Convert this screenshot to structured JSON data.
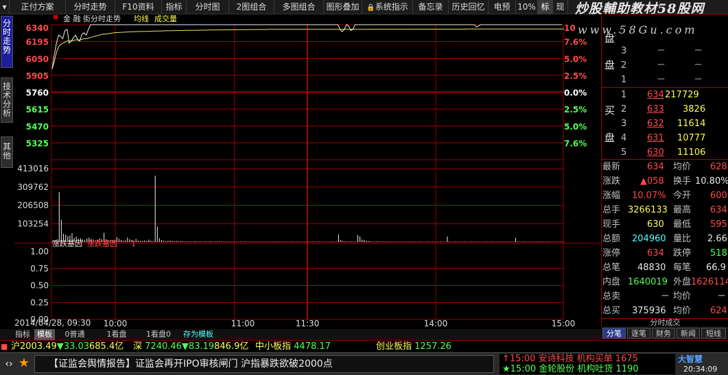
{
  "toolbar": {
    "items": [
      "正付方案",
      "分时走势",
      "F10资料",
      "指标",
      "分时图",
      "2图组合",
      "多图组合",
      "图形叠加",
      "系统指示",
      "备忘录",
      "历史回忆",
      "电预",
      "10%",
      "标",
      "现"
    ]
  },
  "watermark": {
    "line1": "炒股輔助教材58股网",
    "line2": "www.58Gu.com"
  },
  "side_tabs": [
    "分时走势",
    "技术分析",
    "其他"
  ],
  "chart_header": {
    "title": "金 融 街分时走势",
    "avg": "均线",
    "vol": "成交量"
  },
  "indicator_header": {
    "name": "涨跌基因",
    "name2": "涨跌基因",
    "val": "1"
  },
  "date_label": "2014/04/28, 09:30",
  "chart_data": {
    "type": "line",
    "price_ticks": [
      "6340",
      "6195",
      "6050",
      "5905",
      "5760",
      "5615",
      "5470",
      "5325"
    ],
    "pct_ticks": [
      "10",
      "7.6%",
      "5.0%",
      "2.5%",
      "0.0%",
      "2.5%",
      "5.0%",
      "7.6%"
    ],
    "vol_ticks": [
      "413016",
      "309762",
      "206508",
      "103254"
    ],
    "ind_ticks": [
      "1.00",
      "0.75",
      "0.50",
      "0.25",
      "0.00"
    ],
    "time_ticks": [
      "10:00",
      "11:00",
      "11:30",
      "14:00",
      "15:00"
    ],
    "ylim": [
      5180,
      6340
    ],
    "prev_close": 5760,
    "price_series": [
      5960,
      6080,
      6180,
      6250,
      6240,
      6220,
      6290,
      6300,
      6180,
      6200,
      6230,
      6250,
      6210,
      6200,
      6260,
      6270,
      6250,
      6300,
      6340,
      6340,
      6340,
      6340,
      6340,
      6340,
      6340,
      6340,
      6340,
      6340,
      6340,
      6340,
      6340,
      6340,
      6340,
      6340,
      6340,
      6340,
      6340,
      6340,
      6340,
      6340,
      6340,
      6340,
      6340,
      6340,
      6340,
      6340,
      6340,
      6340,
      6340,
      6340,
      6340,
      6340,
      6340,
      6340,
      6340,
      6340,
      6340,
      6340,
      6340,
      6340,
      6340,
      6340,
      6340,
      6340,
      6340,
      6340,
      6340,
      6340,
      6340,
      6340,
      6340,
      6340,
      6340,
      6340,
      6340,
      6340,
      6340,
      6340,
      6340,
      6340,
      6340,
      6340,
      6340,
      6340,
      6340,
      6340,
      6340,
      6340,
      6340,
      6340,
      6340,
      6340,
      6340,
      6340,
      6340,
      6340,
      6340,
      6340,
      6340,
      6340,
      6340,
      6340,
      6340,
      6340,
      6340,
      6340,
      6340,
      6340,
      6340,
      6340,
      6340,
      6340,
      6340,
      6340,
      6340,
      6340,
      6340,
      6340,
      6340,
      6340,
      6340,
      6340,
      6340,
      6340,
      6340,
      6340,
      6340,
      6340,
      6340,
      6340,
      6340,
      6340,
      6340,
      6340,
      6340,
      6300,
      6280,
      6300,
      6340,
      6330,
      6290,
      6300,
      6340,
      6340,
      6340,
      6340,
      6340,
      6340,
      6340,
      6340,
      6340,
      6340,
      6340,
      6340,
      6340,
      6340,
      6340,
      6340,
      6340,
      6340,
      6340,
      6340,
      6340,
      6340,
      6340,
      6340,
      6340,
      6340,
      6340,
      6340,
      6340,
      6340,
      6340,
      6340,
      6340,
      6340,
      6340,
      6340,
      6340,
      6340,
      6340,
      6340,
      6340,
      6340,
      6340,
      6340,
      6340,
      6340,
      6340,
      6340,
      6340,
      6340,
      6340,
      6340,
      6340,
      6340,
      6340,
      6340,
      6340,
      6320,
      6330,
      6340,
      6340,
      6340,
      6340,
      6340,
      6340,
      6340,
      6340,
      6340,
      6340,
      6340,
      6340,
      6340,
      6340,
      6340,
      6340,
      6340,
      6340,
      6340,
      6340,
      6340,
      6340,
      6340,
      6340,
      6340,
      6340,
      6340,
      6340,
      6340,
      6340,
      6340,
      6340,
      6340,
      6340,
      6340,
      6340,
      6340,
      6340,
      6340
    ],
    "avg_series": [
      5960,
      6020,
      6100,
      6150,
      6170,
      6180,
      6190,
      6200,
      6200,
      6200,
      6205,
      6210,
      6210,
      6210,
      6215,
      6220,
      6220,
      6225,
      6230,
      6235,
      6240,
      6245,
      6250,
      6255,
      6258,
      6260,
      6262,
      6265,
      6268,
      6270,
      6272,
      6273,
      6274,
      6275,
      6276,
      6277,
      6278,
      6279,
      6280,
      6280,
      6281,
      6281,
      6282,
      6282,
      6283,
      6283,
      6284,
      6284,
      6285,
      6285,
      6286,
      6286,
      6287,
      6287,
      6288,
      6288,
      6289,
      6289,
      6290,
      6290,
      6290,
      6290,
      6291,
      6291,
      6291,
      6292,
      6292,
      6292,
      6292,
      6293,
      6293,
      6293,
      6293,
      6294,
      6294,
      6294,
      6294,
      6295,
      6295,
      6295,
      6295,
      6295,
      6296,
      6296,
      6296,
      6296,
      6296,
      6297,
      6297,
      6297,
      6297,
      6297,
      6298,
      6298,
      6298,
      6298,
      6298,
      6299,
      6299,
      6299,
      6299,
      6299,
      6300,
      6300,
      6300,
      6300,
      6300,
      6300,
      6300,
      6300,
      6300,
      6300,
      6300,
      6300,
      6300,
      6300,
      6300,
      6300,
      6300,
      6300,
      6300,
      6300,
      6300,
      6300,
      6300,
      6300,
      6300,
      6300,
      6300,
      6300,
      6300,
      6300,
      6300,
      6300,
      6300,
      6300,
      6300,
      6300,
      6300,
      6300,
      6300,
      6300,
      6300,
      6300,
      6300,
      6300,
      6300,
      6300,
      6300,
      6300,
      6301,
      6301,
      6301,
      6301,
      6301,
      6301,
      6301,
      6301,
      6301,
      6301,
      6301,
      6301,
      6301,
      6301,
      6301,
      6301,
      6301,
      6301,
      6301,
      6301,
      6301,
      6302,
      6302,
      6302,
      6302,
      6302,
      6302,
      6302,
      6302,
      6302,
      6302,
      6302,
      6302,
      6302,
      6302,
      6302,
      6302,
      6302,
      6302,
      6302,
      6302,
      6302,
      6302,
      6302,
      6302,
      6303,
      6303,
      6303,
      6303,
      6303,
      6303,
      6303,
      6303,
      6303,
      6303,
      6303,
      6303,
      6303,
      6303,
      6303,
      6303,
      6303,
      6303,
      6303,
      6303,
      6303,
      6303,
      6303,
      6303,
      6303,
      6303,
      6303,
      6303,
      6303,
      6303,
      6303,
      6303,
      6303,
      6303,
      6303,
      6303,
      6303,
      6303,
      6303,
      6303,
      6303,
      6303,
      6303,
      6303,
      6303,
      6303
    ],
    "volume_series": [
      8000,
      12000,
      15000,
      292000,
      130000,
      48000,
      42000,
      35000,
      38000,
      52000,
      24000,
      31000,
      18000,
      22000,
      15000,
      12000,
      20000,
      26000,
      18000,
      14000,
      11000,
      14000,
      22000,
      16000,
      54000,
      16000,
      10000,
      12000,
      9000,
      10000,
      28000,
      18000,
      12000,
      8000,
      10000,
      26000,
      16000,
      12000,
      9000,
      18000,
      8000,
      7000,
      6000,
      9000,
      7000,
      14000,
      8000,
      6000,
      388000,
      90000,
      22000,
      12000,
      8000,
      6000,
      7000,
      8000,
      6000,
      5000,
      6000,
      5000,
      4000,
      5000,
      4000,
      3000,
      4000,
      3000,
      4000,
      5000,
      3000,
      4000,
      3000,
      3000,
      4000,
      3000,
      5000,
      3000,
      3000,
      4000,
      3000,
      3000,
      2000,
      3000,
      2000,
      3000,
      2000,
      3000,
      2000,
      2000,
      3000,
      2000,
      3000,
      2000,
      2000,
      3000,
      2000,
      2000,
      3000,
      2000,
      2000,
      2000,
      3000,
      2000,
      2000,
      2000,
      3000,
      2000,
      2000,
      2000,
      3000,
      2000,
      2000,
      2000,
      3000,
      2000,
      2000,
      3000,
      2000,
      2000,
      2000,
      3000,
      2000,
      2000,
      3000,
      2000,
      2000,
      3000,
      2000,
      2000,
      2000,
      2000,
      2000,
      3000,
      2000,
      2000,
      44000,
      12000,
      6000,
      4000,
      3000,
      3000,
      4000,
      3000,
      3000,
      40000,
      32000,
      14000,
      12000,
      8000,
      6000,
      4000,
      3000,
      3000,
      4000,
      3000,
      2000,
      3000,
      2000,
      3000,
      2000,
      3000,
      2000,
      2000,
      3000,
      2000,
      2000,
      3000,
      2000,
      2000,
      3000,
      2000,
      2000,
      2000,
      3000,
      2000,
      2000,
      2000,
      3000,
      2000,
      3000,
      2000,
      2000,
      2000,
      3000,
      2000,
      2000,
      32000,
      3000,
      2000,
      2000,
      3000,
      2000,
      2000,
      2000,
      3000,
      2000,
      2000,
      3000,
      2000,
      2000,
      3000,
      2000,
      2000,
      2000,
      3000,
      2000,
      2000,
      3000,
      2000,
      2000,
      2000,
      3000,
      2000,
      2000,
      3000,
      2000,
      2000,
      2000,
      24000,
      3000,
      2000,
      2000,
      3000,
      2000,
      2000,
      2000,
      3000,
      2000,
      2000,
      3000,
      2000,
      2000,
      2000,
      3000,
      2000,
      2000,
      2000,
      2000,
      2000,
      2000,
      2000,
      2000
    ]
  },
  "right_panel": {
    "sell_label": "卖",
    "sell_label2": "盘",
    "sell_rows": [
      {
        "n": "3",
        "p": "－",
        "v": "－"
      },
      {
        "n": "2",
        "p": "－",
        "v": "－"
      },
      {
        "n": "1",
        "p": "－",
        "v": "－"
      }
    ],
    "buy_label": "买",
    "buy_label2": "盘",
    "buy_rows": [
      {
        "n": "1",
        "p": "634",
        "v": "217729"
      },
      {
        "n": "2",
        "p": "633",
        "v": "3826"
      },
      {
        "n": "3",
        "p": "632",
        "v": "11614"
      },
      {
        "n": "4",
        "p": "631",
        "v": "10777"
      },
      {
        "n": "5",
        "p": "630",
        "v": "11106"
      }
    ],
    "stats": [
      {
        "l1": "最新",
        "v1": "634",
        "c1": "red",
        "l2": "均价",
        "v2": "628",
        "c2": "red"
      },
      {
        "l1": "涨跌",
        "v1": "▲058",
        "c1": "red",
        "l2": "换手",
        "v2": "10.80%",
        "c2": "wht"
      },
      {
        "l1": "涨幅",
        "v1": "10.07%",
        "c1": "red",
        "l2": "今开",
        "v2": "600",
        "c2": "red"
      },
      {
        "l1": "总手",
        "v1": "3266133",
        "c1": "yel",
        "l2": "最高",
        "v2": "634",
        "c2": "red"
      },
      {
        "l1": "现手",
        "v1": "630",
        "c1": "yel",
        "l2": "最低",
        "v2": "595",
        "c2": "red"
      },
      {
        "l1": "总额",
        "v1": "204960",
        "c1": "cyan",
        "l2": "量比",
        "v2": "2.66",
        "c2": "wht"
      },
      {
        "l1": "涨停",
        "v1": "634",
        "c1": "red",
        "l2": "跌停",
        "v2": "518",
        "c2": "grn"
      },
      {
        "l1": "总笔",
        "v1": "48830",
        "c1": "wht",
        "l2": "每笔",
        "v2": "66.9",
        "c2": "wht"
      },
      {
        "l1": "内盘",
        "v1": "1640019",
        "c1": "grn",
        "l2": "外盘",
        "v2": "1626114",
        "c2": "red"
      },
      {
        "l1": "总卖",
        "v1": "－",
        "c1": "wht",
        "l2": "均价",
        "v2": "－",
        "c2": "wht"
      },
      {
        "l1": "总买",
        "v1": "375936",
        "c1": "wht",
        "l2": "均价",
        "v2": "624",
        "c2": "red"
      }
    ],
    "tick_title": "分时成交"
  },
  "right_tabs": [
    "分笔",
    "逐笔",
    "财务",
    "新闻",
    "短线"
  ],
  "bottom_tabs": [
    "指标",
    "模板",
    "0普通",
    "1看盘",
    "1看盘0",
    "存为模板"
  ],
  "index_bar": {
    "sh_label": "沪",
    "sh_val": "2003.49",
    "sh_chg": "▼33.03",
    "sh_amt": "685.4亿",
    "sz_label": "深",
    "sz_val": "7240.46",
    "sz_chg": "▼83.19",
    "sz_amt": "846.9亿",
    "zx_label": "中小板指",
    "zx_val": "4478.17",
    "cy_label": "创业板指",
    "cy_val": "1257.26"
  },
  "news": {
    "headline": "【证监会舆情报告】证监会再开IPO审核闸门 沪指暴跌欲破2000点",
    "alert1_time": "15:00",
    "alert1_text": "安诗科技 机构买单",
    "alert1_val": "1675",
    "alert2_time": "15:00",
    "alert2_text": "金轮股份 机构吐货",
    "alert2_val": "1190",
    "brand": "大智慧",
    "clock": "20:34:09"
  }
}
